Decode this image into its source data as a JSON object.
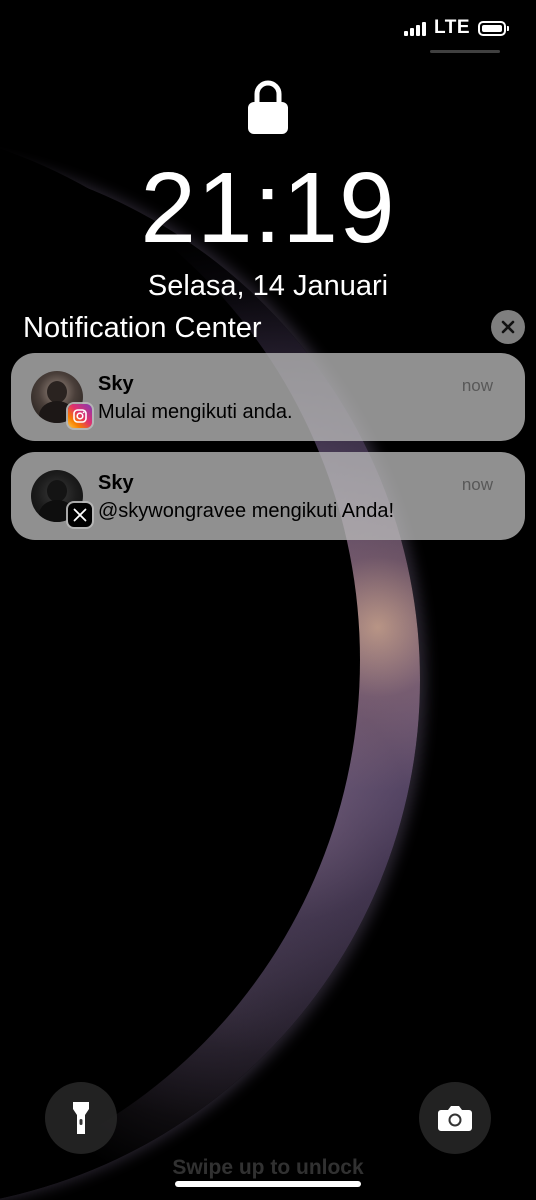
{
  "status_bar": {
    "network": "LTE",
    "signal_bars": 4,
    "battery_icon": "battery-full-icon"
  },
  "lock_icon": "lock-icon",
  "lockscreen": {
    "time": "21:19",
    "date": "Selasa, 14 Januari"
  },
  "notification_center": {
    "title": "Notification Center",
    "close_icon": "close-icon",
    "notifications": [
      {
        "sender": "Sky",
        "message": "Mulai mengikuti anda.",
        "time": "now",
        "app_icon": "instagram-icon"
      },
      {
        "sender": "Sky",
        "message": "@skywongravee mengikuti Anda!",
        "time": "now",
        "app_icon": "x-icon"
      }
    ]
  },
  "bottom": {
    "flashlight_icon": "flashlight-icon",
    "camera_icon": "camera-icon",
    "swipe_hint": "Swipe up to unlock"
  }
}
